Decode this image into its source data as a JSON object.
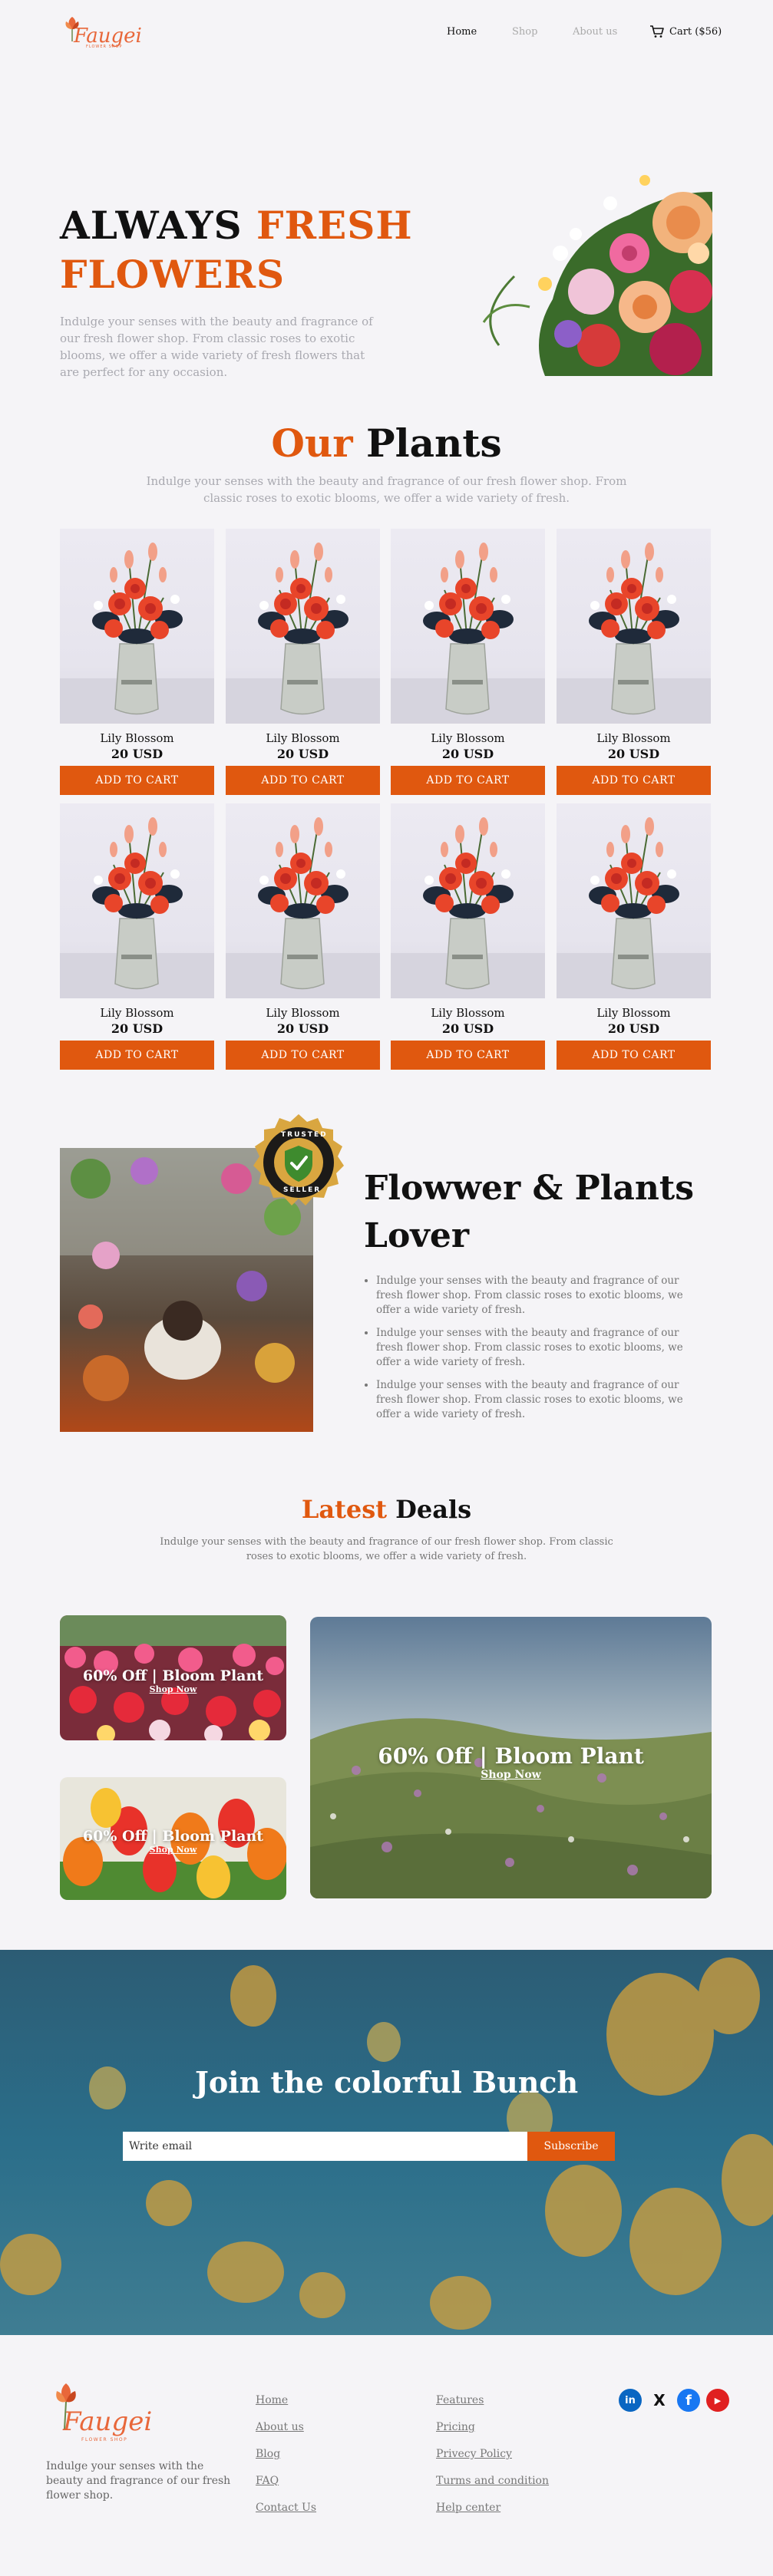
{
  "brand": {
    "name": "Faugei",
    "tagline": "FLOWER SHOP"
  },
  "nav": {
    "home": "Home",
    "shop": "Shop",
    "about": "About us",
    "cart": "Cart ($56)"
  },
  "hero": {
    "title_1": "ALWAYS",
    "title_2": "FRESH",
    "title_3": "FLOWERS",
    "text": "Indulge your senses with the beauty and fragrance of our fresh flower shop. From classic roses to exotic blooms, we offer a wide variety of fresh flowers that are perfect for any occasion."
  },
  "plants": {
    "title_accent": "Our",
    "title_rest": "Plants",
    "subtitle": "Indulge your senses with the beauty and fragrance of our fresh flower shop. From classic roses to exotic blooms, we offer a wide variety of fresh.",
    "products": [
      {
        "name": "Lily Blossom",
        "price": "20 USD",
        "button": "ADD TO CART"
      },
      {
        "name": "Lily Blossom",
        "price": "20 USD",
        "button": "ADD TO CART"
      },
      {
        "name": "Lily Blossom",
        "price": "20 USD",
        "button": "ADD TO CART"
      },
      {
        "name": "Lily Blossom",
        "price": "20 USD",
        "button": "ADD TO CART"
      },
      {
        "name": "Lily Blossom",
        "price": "20 USD",
        "button": "ADD TO CART"
      },
      {
        "name": "Lily Blossom",
        "price": "20 USD",
        "button": "ADD TO CART"
      },
      {
        "name": "Lily Blossom",
        "price": "20 USD",
        "button": "ADD TO CART"
      },
      {
        "name": "Lily Blossom",
        "price": "20 USD",
        "button": "ADD TO CART"
      }
    ]
  },
  "lover": {
    "badge_top": "TRUSTED",
    "badge_bottom": "SELLER",
    "title_1": "Flowwer & Plants",
    "title_2": "Lover",
    "points": [
      "Indulge your senses with the beauty and fragrance of our fresh flower shop. From classic roses to exotic blooms, we offer a wide variety of fresh.",
      "Indulge your senses with the beauty and fragrance of our fresh flower shop. From classic roses to exotic blooms, we offer a wide variety of fresh.",
      "Indulge your senses with the beauty and fragrance of our fresh flower shop. From classic roses to exotic blooms, we offer a wide variety of fresh."
    ]
  },
  "deals": {
    "title_accent": "Latest",
    "title_rest": "Deals",
    "subtitle": "Indulge your senses with the beauty and fragrance of our fresh flower shop. From classic roses to exotic blooms, we offer a wide variety of fresh.",
    "items": [
      {
        "title": "60% Off | Bloom Plant",
        "link": "Shop Now"
      },
      {
        "title": "60% Off | Bloom Plant",
        "link": "Shop Now"
      },
      {
        "title": "60% Off | Bloom Plant",
        "link": "Shop Now"
      }
    ]
  },
  "subscribe": {
    "title": "Join the colorful Bunch",
    "placeholder": "Write email",
    "button": "Subscribe"
  },
  "footer": {
    "text": "Indulge your senses with the beauty and fragrance of our fresh flower shop.",
    "col1": [
      "Home",
      "About us",
      "Blog",
      "FAQ",
      "Contact Us"
    ],
    "col2": [
      "Features",
      "Pricing",
      "Privecy Policy",
      "Turms and condition",
      "Help center"
    ],
    "social": {
      "linkedin": "in",
      "x": "X",
      "facebook": "f",
      "youtube": "▶"
    }
  },
  "colors": {
    "accent": "#e0580f",
    "background": "#f5f4f7"
  }
}
